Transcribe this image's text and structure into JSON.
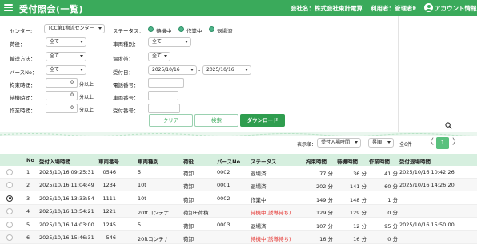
{
  "header": {
    "title": "受付照会(一覧)",
    "company": "会社名：株式会社東計電算",
    "user": "利用者：管理者E",
    "account": "アカウント情報"
  },
  "search": {
    "center_label": "センター:",
    "center_value": "TCC第1物流センター",
    "status_label": "ステータス：",
    "status_options": [
      "待機中",
      "作業中",
      "退場済"
    ],
    "cargo_label": "荷役：",
    "cargo_value": "全て",
    "vehicle_type_label": "車両種別：",
    "vehicle_type_value": "全て",
    "transport_label": "輸送方法：",
    "transport_value": "全て",
    "temp_label": "温度帯：",
    "temp_value": "全て",
    "berth_label": "バースNo：",
    "berth_value": "全て",
    "date_label": "受付日：",
    "date_from": "2025/10/16",
    "date_sep": "-",
    "date_to": "2025/10/16",
    "restraint_label": "拘束時間：",
    "restraint_value": "0",
    "wait_label": "待機時間：",
    "wait_value": "0",
    "work_label": "作業時間：",
    "work_value": "0",
    "unit": "分以上",
    "phone_label": "電話番号：",
    "vehicle_no_label": "車両番号：",
    "receipt_no_label": "受付番号：",
    "clear_label": "クリア",
    "search_label": "検索",
    "download_label": "ダウンロード"
  },
  "list": {
    "sort_label": "表示順：",
    "sort_value": "受付入場時間",
    "order_value": "昇順",
    "count": "全6件",
    "page": "1",
    "prev": "〈",
    "next": "〉",
    "columns": [
      "No",
      "受付入場時間",
      "車両番号",
      "車両種別",
      "荷役",
      "バースNo",
      "ステータス",
      "拘束時間",
      "待機時間",
      "作業時間",
      "受付退場時間"
    ],
    "rows": [
      {
        "no": "1",
        "entry": "2025/10/16 09:25:31",
        "vehicle_no": "0546",
        "vtype": "5",
        "cargo": "荷卸",
        "berth": "0002",
        "status": "退場済",
        "restraint": "77 分",
        "wait": "36 分",
        "work": "41 分",
        "exit": "2025/10/16 10:42:26"
      },
      {
        "no": "2",
        "entry": "2025/10/16 11:04:49",
        "vehicle_no": "1234",
        "vtype": "10t",
        "cargo": "荷卸",
        "berth": "0001",
        "status": "退場済",
        "restraint": "202 分",
        "wait": "141 分",
        "work": "60 分",
        "exit": "2025/10/16 14:26:20"
      },
      {
        "no": "3",
        "entry": "2025/10/16 13:33:54",
        "vehicle_no": "1111",
        "vtype": "10t",
        "cargo": "荷卸",
        "berth": "0002",
        "status": "作業中",
        "restraint": "149 分",
        "wait": "148 分",
        "work": "1 分",
        "exit": ""
      },
      {
        "no": "4",
        "entry": "2025/10/16 13:54:21",
        "vehicle_no": "1221",
        "vtype": "20ftコンテナ",
        "cargo": "荷卸+荷積",
        "berth": "",
        "status": "待機中(誘導待ち)",
        "restraint": "129 分",
        "wait": "129 分",
        "work": "0 分",
        "exit": ""
      },
      {
        "no": "5",
        "entry": "2025/10/16 14:03:00",
        "vehicle_no": "1245",
        "vtype": "5",
        "cargo": "荷卸",
        "berth": "0003",
        "status": "退場済",
        "restraint": "107 分",
        "wait": "12 分",
        "work": "95 分",
        "exit": "2025/10/16 15:50:00"
      },
      {
        "no": "6",
        "entry": "2025/10/16 15:46:31",
        "vehicle_no": "546",
        "vtype": "20ftコンテナ",
        "cargo": "荷卸",
        "berth": "",
        "status": "待機中(誘導待ち)",
        "restraint": "16 分",
        "wait": "16 分",
        "work": "0 分",
        "exit": ""
      }
    ]
  },
  "colors": {
    "brand": "#3aaa5b",
    "header_row": "#d6efdf",
    "alert_text": "#e53935"
  }
}
